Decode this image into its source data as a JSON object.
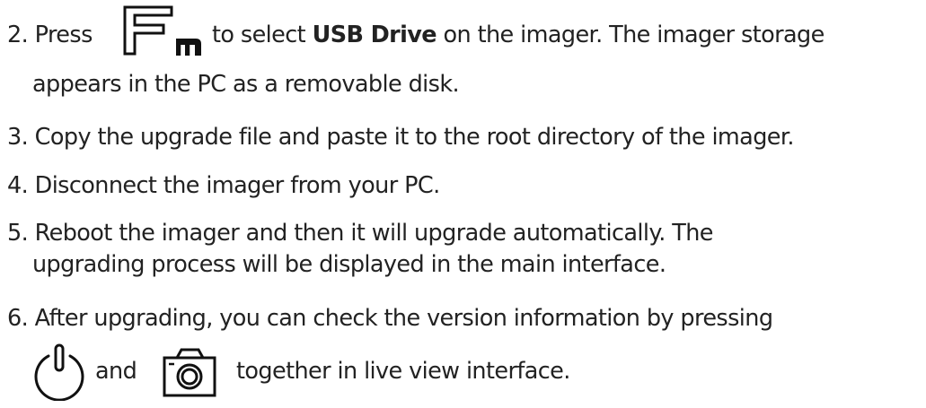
{
  "steps": [
    {
      "number": "2.",
      "text_before_icon": "Press",
      "icon": "fn-key-icon",
      "text_after_icon": "to select",
      "bold": "USB Drive",
      "text_tail": "on the imager. The imager storage",
      "continuation": "appears in the PC as a removable disk."
    },
    {
      "number": "3.",
      "text": "Copy the upgrade file and paste it to the root directory of the imager."
    },
    {
      "number": "4.",
      "text": "Disconnect the imager from your PC."
    },
    {
      "number": "5.",
      "text": "Reboot the imager and then it will upgrade automatically. The",
      "continuation": "upgrading process will be displayed in the main interface."
    },
    {
      "number": "6.",
      "text": "After upgrading, you can check the version information by pressing",
      "icon1": "power-button-icon",
      "connector": "and",
      "icon2": "camera-button-icon",
      "tail": "together in live view interface."
    }
  ]
}
